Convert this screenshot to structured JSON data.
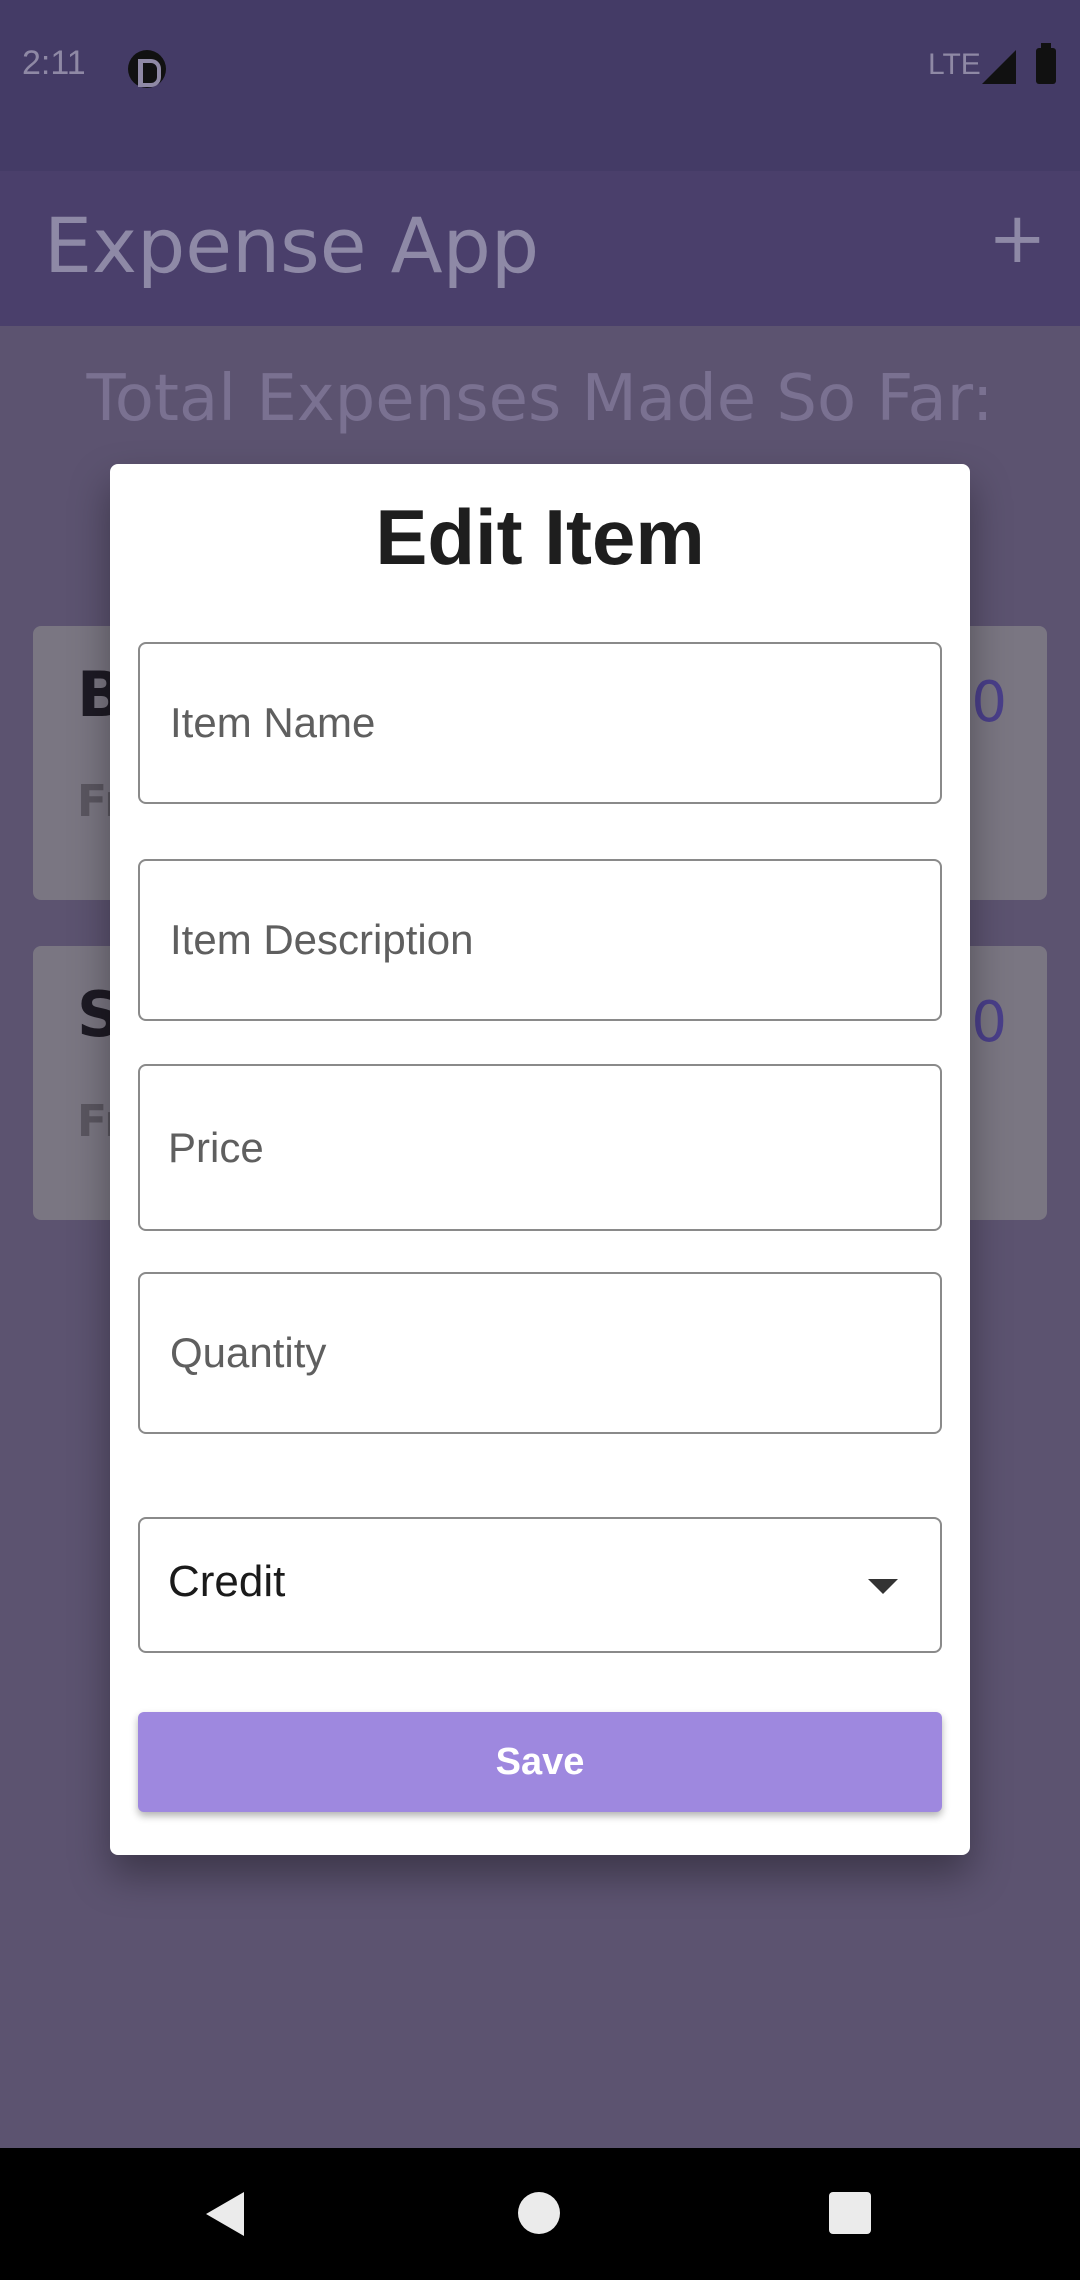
{
  "status_bar": {
    "time": "2:11",
    "network": "LTE",
    "icons": [
      "app-notification-icon",
      "signal-icon",
      "battery-icon"
    ]
  },
  "app_bar": {
    "title": "Expense App",
    "add_label": "+"
  },
  "background": {
    "total_label": "Total Expenses Made So Far:",
    "cards": [
      {
        "title": "B",
        "subtitle": "Fr",
        "amount": "0"
      },
      {
        "title": "S",
        "subtitle": "Fr",
        "amount": "0"
      }
    ]
  },
  "dialog": {
    "title": "Edit Item",
    "fields": {
      "item_name_placeholder": "Item Name",
      "item_description_placeholder": "Item Description",
      "price_placeholder": "Price",
      "quantity_placeholder": "Quantity"
    },
    "payment_type": {
      "selected": "Credit"
    },
    "save_label": "Save",
    "colors": {
      "save_button": "#9e88df",
      "scrim_app_bar": "#4a3f6b"
    }
  },
  "nav_bar": {
    "icons": [
      "back-icon",
      "home-icon",
      "recents-icon"
    ]
  }
}
